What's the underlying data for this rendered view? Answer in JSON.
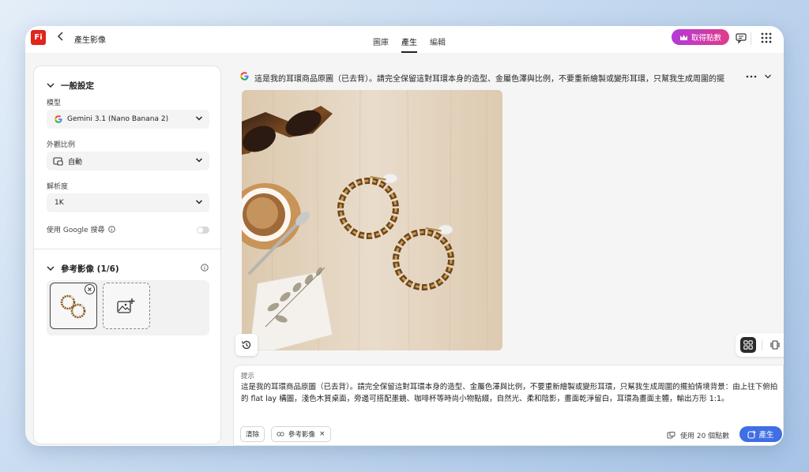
{
  "app": {
    "logo": "Fi",
    "title": "產生影像"
  },
  "tabs": [
    {
      "label": "圖庫"
    },
    {
      "label": "產生"
    },
    {
      "label": "編輯"
    }
  ],
  "header": {
    "credits_button": "取得點數"
  },
  "settings": {
    "section_title": "一般設定",
    "model": {
      "label": "模型",
      "value": "Gemini 3.1 (Nano Banana 2)"
    },
    "aspect": {
      "label": "外觀比例",
      "value": "自動"
    },
    "resolution": {
      "label": "解析度",
      "value": "1K"
    },
    "google_search": {
      "label": "使用 Google 搜尋",
      "enabled": false
    }
  },
  "reference": {
    "title": "參考影像 (1/6)"
  },
  "main": {
    "prompt_header": "這是我的耳環商品原圖（已去背）。請完全保留這對耳環本身的造型、金屬色澤與比例，不要重新繪製或變形耳環，只幫我生成周圍的擺"
  },
  "prompt_box": {
    "label": "提示",
    "text": "這是我的耳環商品原圖（已去背）。請完全保留這對耳環本身的造型、金屬色澤與比例，不要重新繪製或變形耳環，只幫我生成周圍的擺拍情境背景：由上往下俯拍的 flat lay 構圖，淺色木質桌面，旁邊可搭配墨鏡、咖啡杯等時尚小物點綴，自然光、柔和陰影，畫面乾淨留白，耳環為畫面主體，輸出方形 1:1。",
    "clear_button": "清除",
    "ref_chip": "參考影像",
    "cost": "使用 20 個點數",
    "generate_button": "產生"
  },
  "colors": {
    "brand": "#e1251b",
    "accent": "#3f6ee5",
    "credits": "#c03ab8"
  },
  "icons": [
    "back-icon",
    "crown-icon",
    "feedback-icon",
    "apps-grid-icon",
    "chevron-down-icon",
    "google-icon",
    "aspect-icon",
    "info-icon",
    "close-icon",
    "image-upload-icon",
    "history-icon",
    "grid-view-icon",
    "single-view-icon",
    "more-icon",
    "link-icon",
    "credit-icon",
    "sparkle-icon"
  ]
}
